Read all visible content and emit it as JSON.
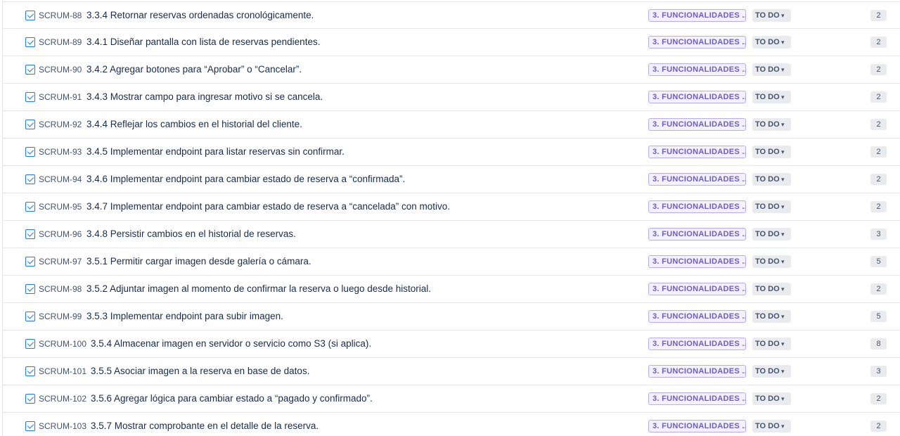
{
  "status_label": "TO DO",
  "chevron": "▾",
  "colors": {
    "accent": "#1d7afc",
    "epic_bg": "#f3f0ff",
    "epic_text": "#6e5dc6",
    "status_bg": "#e9ebee"
  },
  "icons": {
    "issue_type": "checkbox-task-icon",
    "status_dropdown": "chevron-down-icon"
  },
  "issues": [
    {
      "key": "SCRUM-88",
      "summary": "3.3.4 Retornar reservas ordenadas cronológicamente.",
      "epic": "3. FUNCIONALIDADES ...",
      "points": "2"
    },
    {
      "key": "SCRUM-89",
      "summary": "3.4.1 Diseñar pantalla con lista de reservas pendientes.",
      "epic": "3. FUNCIONALIDADES ...",
      "points": "2"
    },
    {
      "key": "SCRUM-90",
      "summary": "3.4.2 Agregar botones para “Aprobar” o “Cancelar”.",
      "epic": "3. FUNCIONALIDADES ...",
      "points": "2"
    },
    {
      "key": "SCRUM-91",
      "summary": "3.4.3 Mostrar campo para ingresar motivo si se cancela.",
      "epic": "3. FUNCIONALIDADES ...",
      "points": "2"
    },
    {
      "key": "SCRUM-92",
      "summary": "3.4.4 Reflejar los cambios en el historial del cliente.",
      "epic": "3. FUNCIONALIDADES ...",
      "points": "2"
    },
    {
      "key": "SCRUM-93",
      "summary": "3.4.5 Implementar endpoint para listar reservas sin confirmar.",
      "epic": "3. FUNCIONALIDADES ...",
      "points": "2"
    },
    {
      "key": "SCRUM-94",
      "summary": "3.4.6 Implementar endpoint para cambiar estado de reserva a “confirmada”.",
      "epic": "3. FUNCIONALIDADES ...",
      "points": "2"
    },
    {
      "key": "SCRUM-95",
      "summary": "3.4.7 Implementar endpoint para cambiar estado de reserva a “cancelada” con motivo.",
      "epic": "3. FUNCIONALIDADES ...",
      "points": "2"
    },
    {
      "key": "SCRUM-96",
      "summary": "3.4.8 Persistir cambios en el historial de reservas.",
      "epic": "3. FUNCIONALIDADES ...",
      "points": "3"
    },
    {
      "key": "SCRUM-97",
      "summary": "3.5.1 Permitir cargar imagen desde galería o cámara.",
      "epic": "3. FUNCIONALIDADES ...",
      "points": "5"
    },
    {
      "key": "SCRUM-98",
      "summary": "3.5.2 Adjuntar imagen al momento de confirmar la reserva o luego desde historial.",
      "epic": "3. FUNCIONALIDADES ...",
      "points": "2"
    },
    {
      "key": "SCRUM-99",
      "summary": "3.5.3 Implementar endpoint para subir imagen.",
      "epic": "3. FUNCIONALIDADES ...",
      "points": "5"
    },
    {
      "key": "SCRUM-100",
      "summary": "3.5.4 Almacenar imagen en servidor o servicio como S3 (si aplica).",
      "epic": "3. FUNCIONALIDADES ...",
      "points": "8"
    },
    {
      "key": "SCRUM-101",
      "summary": "3.5.5 Asociar imagen a la reserva en base de datos.",
      "epic": "3. FUNCIONALIDADES ...",
      "points": "3"
    },
    {
      "key": "SCRUM-102",
      "summary": "3.5.6 Agregar lógica para cambiar estado a “pagado y confirmado”.",
      "epic": "3. FUNCIONALIDADES ...",
      "points": "2"
    },
    {
      "key": "SCRUM-103",
      "summary": "3.5.7 Mostrar comprobante en el detalle de la reserva.",
      "epic": "3. FUNCIONALIDADES ...",
      "points": "2"
    }
  ]
}
